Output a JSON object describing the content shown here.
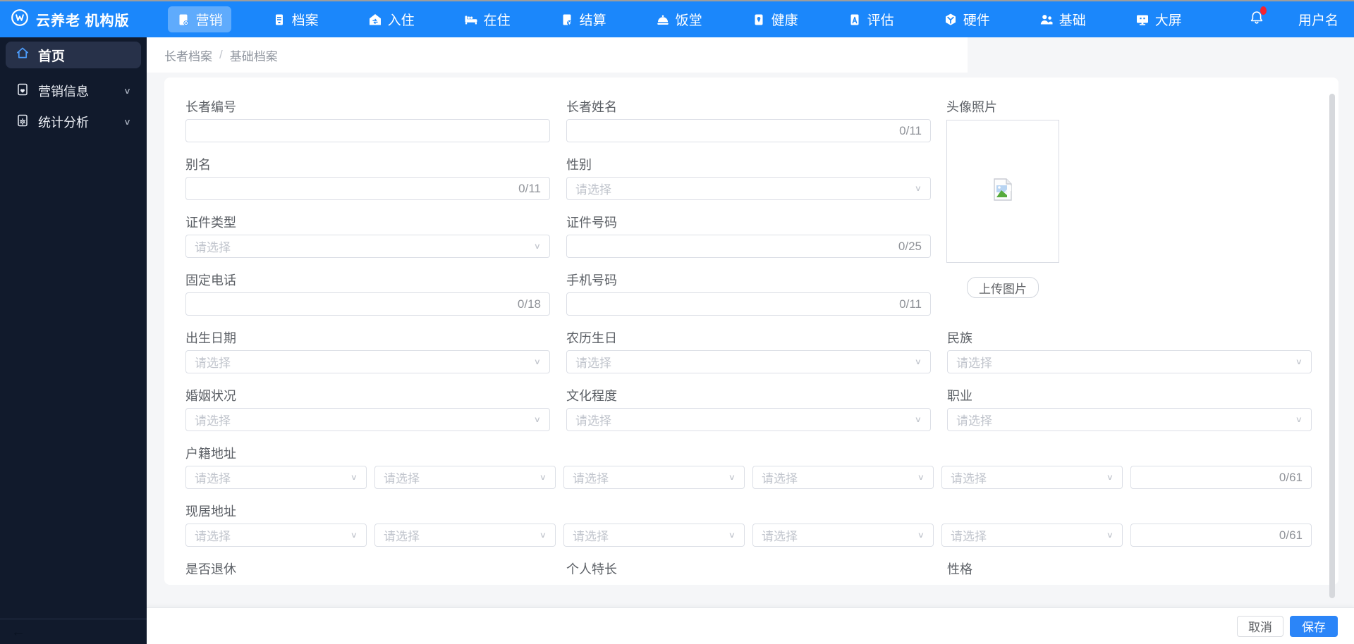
{
  "topbar": {
    "logo_icon": "cloud-elderly-logo",
    "title": "云养老 机构版",
    "nav_items": [
      {
        "name": "marketing",
        "label": "营销",
        "icon": "marketing-icon",
        "active": true
      },
      {
        "name": "archives",
        "label": "档案",
        "icon": "archive-icon",
        "active": false
      },
      {
        "name": "checkin",
        "label": "入住",
        "icon": "checkin-icon",
        "active": false
      },
      {
        "name": "residence",
        "label": "在住",
        "icon": "bed-icon",
        "active": false
      },
      {
        "name": "settlement",
        "label": "结算",
        "icon": "settlement-icon",
        "active": false
      },
      {
        "name": "canteen",
        "label": "饭堂",
        "icon": "canteen-icon",
        "active": false
      },
      {
        "name": "health",
        "label": "健康",
        "icon": "health-icon",
        "active": false
      },
      {
        "name": "assessment",
        "label": "评估",
        "icon": "assessment-icon",
        "active": false
      },
      {
        "name": "hardware",
        "label": "硬件",
        "icon": "hardware-icon",
        "active": false
      },
      {
        "name": "basic",
        "label": "基础",
        "icon": "basic-icon",
        "active": false
      },
      {
        "name": "bigscreen",
        "label": "大屏",
        "icon": "bigscreen-icon",
        "active": false
      }
    ],
    "notification": {
      "icon": "bell-icon",
      "has_badge": true
    },
    "username": "用户名"
  },
  "sidebar": {
    "items": [
      {
        "name": "home",
        "label": "首页",
        "icon": "home-icon",
        "active": true,
        "expandable": false
      },
      {
        "name": "marketing-info",
        "label": "营销信息",
        "icon": "doc-heart-icon",
        "active": false,
        "expandable": true
      },
      {
        "name": "statistics",
        "label": "统计分析",
        "icon": "doc-gear-icon",
        "active": false,
        "expandable": true
      }
    ],
    "collapse_arrow": "←"
  },
  "breadcrumb": {
    "items": [
      "长者档案",
      "基础档案"
    ],
    "separator": "/"
  },
  "form": {
    "select_placeholder": "请选择",
    "rows": [
      {
        "type": "fields",
        "fields": [
          {
            "name": "elder-no",
            "label": "长者编号",
            "type": "input",
            "value": "",
            "counter": ""
          },
          {
            "name": "elder-name",
            "label": "长者姓名",
            "type": "input",
            "value": "",
            "counter": "0/11"
          }
        ]
      },
      {
        "type": "fields",
        "fields": [
          {
            "name": "alias",
            "label": "别名",
            "type": "input",
            "value": "",
            "counter": "0/11"
          },
          {
            "name": "gender",
            "label": "性别",
            "type": "select"
          }
        ]
      },
      {
        "type": "fields",
        "fields": [
          {
            "name": "id-type",
            "label": "证件类型",
            "type": "select"
          },
          {
            "name": "id-number",
            "label": "证件号码",
            "type": "input",
            "value": "",
            "counter": "0/25"
          }
        ]
      },
      {
        "type": "fields",
        "fields": [
          {
            "name": "landline",
            "label": "固定电话",
            "type": "input",
            "value": "",
            "counter": "0/18"
          },
          {
            "name": "mobile",
            "label": "手机号码",
            "type": "input",
            "value": "",
            "counter": "0/11"
          }
        ]
      },
      {
        "type": "fields",
        "fields": [
          {
            "name": "birth-date",
            "label": "出生日期",
            "type": "select"
          },
          {
            "name": "lunar-birthday",
            "label": "农历生日",
            "type": "select"
          },
          {
            "name": "ethnicity",
            "label": "民族",
            "type": "select"
          }
        ]
      },
      {
        "type": "fields",
        "fields": [
          {
            "name": "marital-status",
            "label": "婚姻状况",
            "type": "select"
          },
          {
            "name": "education",
            "label": "文化程度",
            "type": "select"
          },
          {
            "name": "occupation",
            "label": "职业",
            "type": "select"
          }
        ]
      },
      {
        "type": "address",
        "name": "household-address",
        "label": "户籍地址",
        "select_count": 5,
        "counter": "0/61",
        "value": ""
      },
      {
        "type": "address",
        "name": "current-address",
        "label": "现居地址",
        "select_count": 5,
        "counter": "0/61",
        "value": ""
      },
      {
        "type": "labels",
        "items": [
          {
            "name": "retired",
            "label": "是否退休"
          },
          {
            "name": "specialty",
            "label": "个人特长"
          },
          {
            "name": "personality",
            "label": "性格"
          }
        ]
      }
    ],
    "avatar": {
      "label": "头像照片",
      "button": "上传图片",
      "icon": "broken-image-icon"
    }
  },
  "footer": {
    "cancel": "取消",
    "save": "保存"
  },
  "colors": {
    "topbar_blue": "#1b87fb",
    "nav_active_pill": "rgba(255,255,255,0.30)",
    "sidebar_bg": "#111a2c",
    "sidebar_active_pill": "#273149",
    "sidebar_home_icon": "#4c9cfb",
    "page_bg": "#f5f6f8",
    "primary_button": "#2b85f8",
    "input_border": "#dcdfe6",
    "placeholder_text": "#c0c4cc",
    "label_text": "#5c6066",
    "counter_text": "#909399",
    "breadcrumb_text": "#8f959e",
    "badge_red": "#f5222d"
  }
}
